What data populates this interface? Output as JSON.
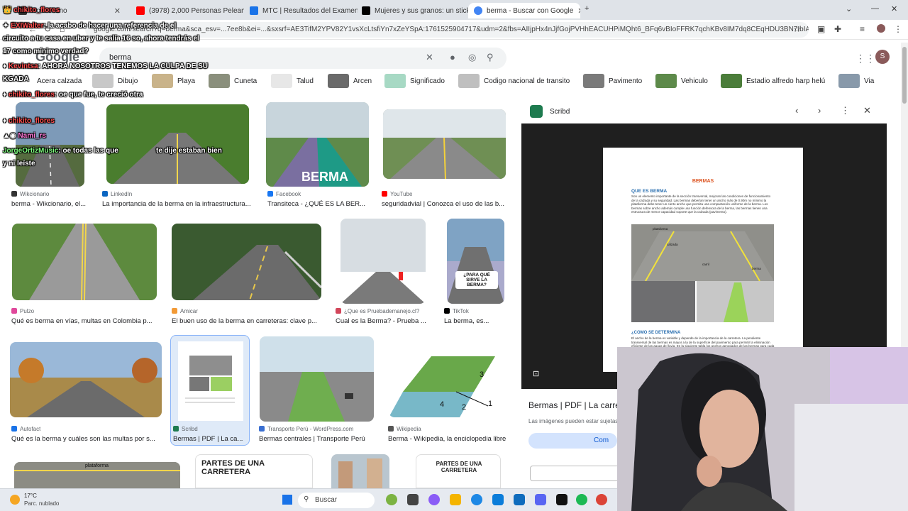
{
  "browser": {
    "tabs": [
      {
        "label": "Hola chuno",
        "color": "#333333"
      },
      {
        "label": "(3978) 2,000 Personas Pelean P...",
        "color": "#ff0000"
      },
      {
        "label": "MTC | Resultados del Examen d...",
        "color": "#1a73e8"
      },
      {
        "label": "Mujeres y sus granos: un sticke...",
        "color": "#000000"
      },
      {
        "label": "berma - Buscar con Google",
        "color": "#4285f4"
      }
    ],
    "address": "google.com/search?q=berma&sca_esv=...7ee8b&ei=...&sxsrf=AE3TifM2YPV82Y1vsXcLtsfiYn7xZeYSpA:1761525904717&udm=2&fbs=AIIjpHx4nJjfGojPVHhEACUHPiMQht6_BFq6vBIoFFRK7qchKBv8IM7dq8CEqHDU3BN7IbIAhsJT8_A_Kaclg0iocpn1..."
  },
  "google": {
    "logo": "Google",
    "query": "berma",
    "avatar_letter": "S",
    "chips": [
      {
        "label": "Acera calzada"
      },
      {
        "label": "Dibujo"
      },
      {
        "label": "Playa"
      },
      {
        "label": "Cuneta"
      },
      {
        "label": "Talud"
      },
      {
        "label": "Arcen"
      },
      {
        "label": "Significado"
      },
      {
        "label": "Codigo nacional de transito"
      },
      {
        "label": "Pavimento"
      },
      {
        "label": "Vehiculo"
      },
      {
        "label": "Estadio alfredo harp helú"
      },
      {
        "label": "Via"
      }
    ],
    "results": [
      {
        "source": "Wikcionario",
        "title": "berma - Wikcionario, el..."
      },
      {
        "source": "LinkedIn",
        "title": "La importancia de la berma en la infraestructura..."
      },
      {
        "source": "Facebook",
        "title": "Transiteca - ¿QUÉ ES LA BER..."
      },
      {
        "source": "YouTube",
        "title": "seguridadvial | Conozca el uso de las b..."
      },
      {
        "source": "Pulzo",
        "title": "Qué es berma en vías, multas en Colombia p..."
      },
      {
        "source": "Amicar",
        "title": "El buen uso de la berma en carreteras: clave p..."
      },
      {
        "source": "¿Que es Pruebademanejo.cl?",
        "title": "Cual es la Berma? - Prueba ..."
      },
      {
        "source": "TikTok",
        "title": "La berma, es..."
      },
      {
        "source": "Autofact",
        "title": "Qué es la berma y cuáles son las multas por s..."
      },
      {
        "source": "Scribd",
        "title": "Bermas | PDF | La ca..."
      },
      {
        "source": "Transporte Perú - WordPress.com",
        "title": "Bermas centrales | Transporte Perú"
      },
      {
        "source": "Wikipedia",
        "title": "Berma - Wikipedia, la enciclopedia libre"
      }
    ],
    "berma_overlay": "BERMA",
    "tiktok_overlay": "¿PARA QUÉ SIRVE LA BERMA?",
    "carretera_1": "PARTES DE UNA CARRETERA",
    "carretera_2": "PARTES DE UNA CARRETERA",
    "plataforma": "plataforma",
    "diagram_numbers": [
      "3",
      "4",
      "2",
      "1"
    ]
  },
  "preview": {
    "site": "Scribd",
    "title": "Bermas | PDF | La carret",
    "notice": "Las imágenes pueden estar sujetas",
    "share": "Com",
    "doc_heading": "BERMAS",
    "doc_sub1": "QUE ES BERMA",
    "doc_sub2": "¿COMO SE DETERMINA",
    "doc_labels": [
      "plataforma",
      "calzada",
      "carril",
      "berma"
    ],
    "doc_text1": "Son un elemento importante de la sección transversal, mejoran las condiciones de funcionamiento de la calzada y su seguridad. Las bermas deberían tener un ancho más de 0.90m no mínimo la plataforma debe tener un cierto ancho que permita una compactación uniforme de la berma. Los bermas sobre ancho además cumple una función defensora de la berma, las bermas tienen una estructura de menor capacidad soporte que la calzada (pavimento).",
    "doc_text2": "El ancho de la berma es variable y depende de la importancia de la carretera. La pendiente transversal de las bermas es mayor a la de la superficie del pavimento para permitir la eliminación eficiente de las aguas de lluvia. En la siguiente tabla los anchos apropiados de las bermas para cada velocidad directriz se han tomado en cuenta los volúmenes de tráfico y de costos de construcción."
  },
  "chat": [
    {
      "name": "chikito_flores",
      "msg": ""
    },
    {
      "name": "EXIWalter",
      "msg": ": la acabo de hacer una referencia de el"
    },
    {
      "name": "",
      "msg": "circuito a tu casa en uber y te salía 16 so, ahora tendrás el"
    },
    {
      "name": "",
      "msg": "17 como mínimo verdad?"
    },
    {
      "name": "Kevintsa",
      "msg": ": AHORA NOSOTROS TENEMOS LA CULPA DE SU"
    },
    {
      "name": "",
      "msg": "KGADA"
    },
    {
      "name": "chikito_flores",
      "msg": ": oe que fue, te creció otra"
    },
    {
      "name": "chikito_flores",
      "msg": ""
    },
    {
      "name": "Nami_rs",
      "msg": ""
    },
    {
      "name": "JorgeOrtizMusic",
      "msg": ": oe todas las que"
    },
    {
      "name": "",
      "msg": "te dije estaban bien"
    },
    {
      "name": "",
      "msg": "y ni leíste"
    }
  ],
  "taskbar": {
    "temp": "17°C",
    "weather": "Parc. nublado",
    "search": "Buscar"
  },
  "colors": {
    "accent": "#1a73e8",
    "chat_name": "#ff4e4e",
    "scribd": "#1e7b4f"
  }
}
